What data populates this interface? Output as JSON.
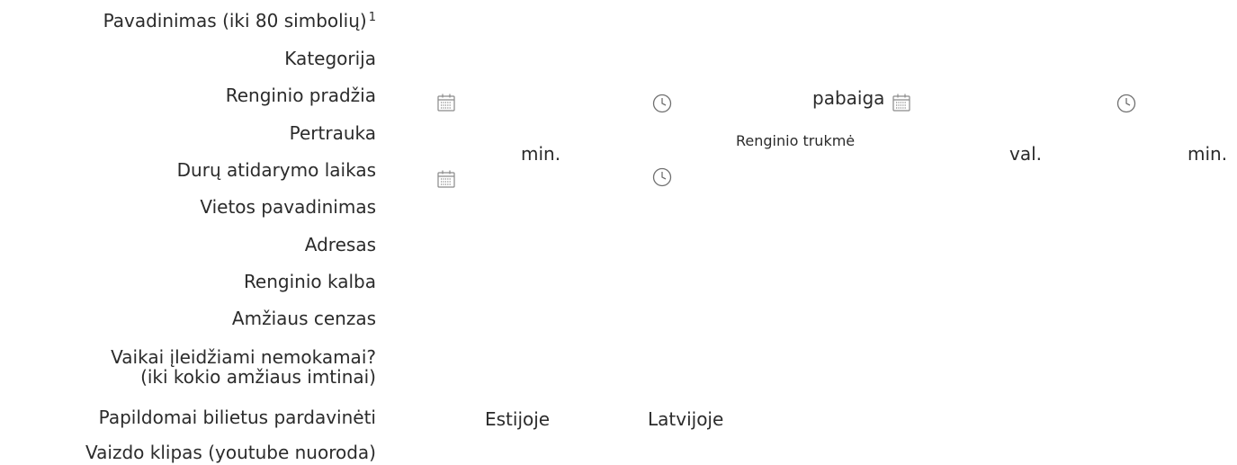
{
  "form": {
    "labels": {
      "title": "Pavadinimas (iki 80 simbolių)",
      "title_note": "1",
      "category": "Kategorija",
      "event_start": "Renginio pradžia",
      "break": "Pertrauka",
      "doors_open": "Durų atidarymo laikas",
      "venue_name": "Vietos pavadinimas",
      "address": "Adresas",
      "event_language": "Renginio kalba",
      "age_rating": "Amžiaus cenzas",
      "children_free_line1": "Vaikai įleidžiami nemokamai?",
      "children_free_line2": "(iki kokio amžiaus imtinai)",
      "extra_sales": "Papildomai bilietus pardavinėti",
      "video_clip": "Vaizdo klipas (youtube nuoroda)"
    },
    "inline": {
      "end_label": "pabaiga",
      "break_unit": "min.",
      "duration_label": "Renginio trukmė",
      "hours_unit": "val.",
      "minutes_unit": "min.",
      "estonia": "Estijoje",
      "latvia": "Latvijoje"
    },
    "icons": {
      "calendar": "calendar-icon",
      "clock": "clock-icon"
    }
  }
}
